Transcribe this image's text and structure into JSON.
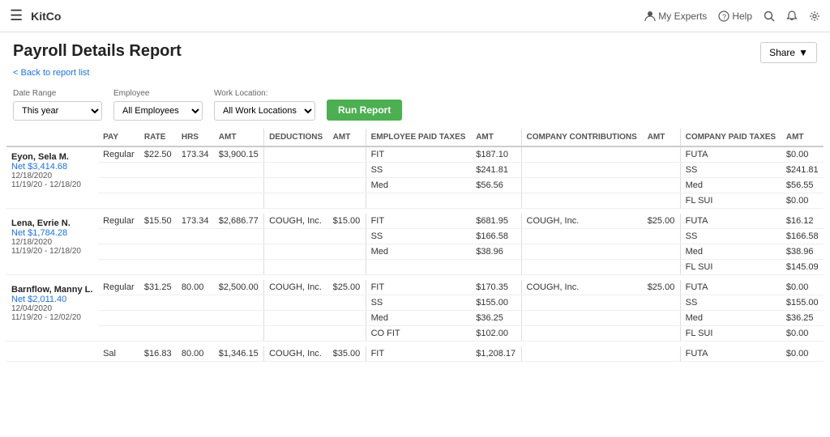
{
  "app": {
    "brand": "KitCo",
    "nav_items": [
      "My Experts",
      "Help"
    ]
  },
  "page": {
    "title": "Payroll Details Report",
    "back_label": "< Back to report list",
    "share_label": "Share"
  },
  "filters": {
    "date_range_label": "Date Range",
    "date_range_value": "This year",
    "employee_label": "Employee",
    "employee_value": "All Employees",
    "work_location_label": "Work Location:",
    "work_location_value": "All Work Locations",
    "run_button": "Run Report"
  },
  "table": {
    "headers": [
      {
        "id": "pay",
        "label": "PAY"
      },
      {
        "id": "rate",
        "label": "RATE"
      },
      {
        "id": "hrs",
        "label": "HRS"
      },
      {
        "id": "amt",
        "label": "AMT"
      },
      {
        "id": "deductions",
        "label": "DEDUCTIONS"
      },
      {
        "id": "ded_amt",
        "label": "AMT"
      },
      {
        "id": "emp_taxes",
        "label": "EMPLOYEE PAID TAXES"
      },
      {
        "id": "emp_amt",
        "label": "AMT"
      },
      {
        "id": "company_contrib",
        "label": "COMPANY CONTRIBUTIONS"
      },
      {
        "id": "contrib_amt",
        "label": "AMT"
      },
      {
        "id": "company_taxes",
        "label": "COMPANY PAID TAXES"
      },
      {
        "id": "tax_amt",
        "label": "AMT"
      }
    ],
    "employees": [
      {
        "name": "Eyon, Sela M.",
        "net": "$3,414.68",
        "date1": "12/18/2020",
        "date2": "11/19/20 - 12/18/20",
        "rows": [
          {
            "pay": "Regular",
            "rate": "$22.50",
            "hrs": "173.34",
            "amt": "$3,900.15",
            "deduction": "",
            "ded_amt": "",
            "emp_tax": "FIT",
            "emp_amt": "$187.10",
            "contrib": "",
            "contrib_amt": "",
            "company_tax": "FUTA",
            "tax_amt": "$0.00"
          },
          {
            "pay": "",
            "rate": "",
            "hrs": "",
            "amt": "",
            "deduction": "",
            "ded_amt": "",
            "emp_tax": "SS",
            "emp_amt": "$241.81",
            "contrib": "",
            "contrib_amt": "",
            "company_tax": "SS",
            "tax_amt": "$241.81"
          },
          {
            "pay": "",
            "rate": "",
            "hrs": "",
            "amt": "",
            "deduction": "",
            "ded_amt": "",
            "emp_tax": "Med",
            "emp_amt": "$56.56",
            "contrib": "",
            "contrib_amt": "",
            "company_tax": "Med",
            "tax_amt": "$56.55"
          },
          {
            "pay": "",
            "rate": "",
            "hrs": "",
            "amt": "",
            "deduction": "",
            "ded_amt": "",
            "emp_tax": "",
            "emp_amt": "",
            "contrib": "",
            "contrib_amt": "",
            "company_tax": "FL SUI",
            "tax_amt": "$0.00"
          }
        ]
      },
      {
        "name": "Lena, Evrie N.",
        "net": "$1,784.28",
        "date1": "12/18/2020",
        "date2": "11/19/20 - 12/18/20",
        "rows": [
          {
            "pay": "Regular",
            "rate": "$15.50",
            "hrs": "173.34",
            "amt": "$2,686.77",
            "deduction": "COUGH, Inc.",
            "ded_amt": "$15.00",
            "emp_tax": "FIT",
            "emp_amt": "$681.95",
            "contrib": "COUGH, Inc.",
            "contrib_amt": "$25.00",
            "company_tax": "FUTA",
            "tax_amt": "$16.12"
          },
          {
            "pay": "",
            "rate": "",
            "hrs": "",
            "amt": "",
            "deduction": "",
            "ded_amt": "",
            "emp_tax": "SS",
            "emp_amt": "$166.58",
            "contrib": "",
            "contrib_amt": "",
            "company_tax": "SS",
            "tax_amt": "$166.58"
          },
          {
            "pay": "",
            "rate": "",
            "hrs": "",
            "amt": "",
            "deduction": "",
            "ded_amt": "",
            "emp_tax": "Med",
            "emp_amt": "$38.96",
            "contrib": "",
            "contrib_amt": "",
            "company_tax": "Med",
            "tax_amt": "$38.96"
          },
          {
            "pay": "",
            "rate": "",
            "hrs": "",
            "amt": "",
            "deduction": "",
            "ded_amt": "",
            "emp_tax": "",
            "emp_amt": "",
            "contrib": "",
            "contrib_amt": "",
            "company_tax": "FL SUI",
            "tax_amt": "$145.09"
          }
        ]
      },
      {
        "name": "Barnflow, Manny L.",
        "net": "$2,011.40",
        "date1": "12/04/2020",
        "date2": "11/19/20 - 12/02/20",
        "rows": [
          {
            "pay": "Regular",
            "rate": "$31.25",
            "hrs": "80.00",
            "amt": "$2,500.00",
            "deduction": "COUGH, Inc.",
            "ded_amt": "$25.00",
            "emp_tax": "FIT",
            "emp_amt": "$170.35",
            "contrib": "COUGH, Inc.",
            "contrib_amt": "$25.00",
            "company_tax": "FUTA",
            "tax_amt": "$0.00"
          },
          {
            "pay": "",
            "rate": "",
            "hrs": "",
            "amt": "",
            "deduction": "",
            "ded_amt": "",
            "emp_tax": "SS",
            "emp_amt": "$155.00",
            "contrib": "",
            "contrib_amt": "",
            "company_tax": "SS",
            "tax_amt": "$155.00"
          },
          {
            "pay": "",
            "rate": "",
            "hrs": "",
            "amt": "",
            "deduction": "",
            "ded_amt": "",
            "emp_tax": "Med",
            "emp_amt": "$36.25",
            "contrib": "",
            "contrib_amt": "",
            "company_tax": "Med",
            "tax_amt": "$36.25"
          },
          {
            "pay": "",
            "rate": "",
            "hrs": "",
            "amt": "",
            "deduction": "",
            "ded_amt": "",
            "emp_tax": "CO FIT",
            "emp_amt": "$102.00",
            "contrib": "",
            "contrib_amt": "",
            "company_tax": "FL SUI",
            "tax_amt": "$0.00"
          }
        ]
      },
      {
        "name": "",
        "net": "",
        "date1": "",
        "date2": "",
        "rows": [
          {
            "pay": "Sal",
            "rate": "$16.83",
            "hrs": "80.00",
            "amt": "$1,346.15",
            "deduction": "COUGH, Inc.",
            "ded_amt": "$35.00",
            "emp_tax": "FIT",
            "emp_amt": "$1,208.17",
            "contrib": "",
            "contrib_amt": "",
            "company_tax": "FUTA",
            "tax_amt": "$0.00"
          }
        ]
      }
    ]
  }
}
